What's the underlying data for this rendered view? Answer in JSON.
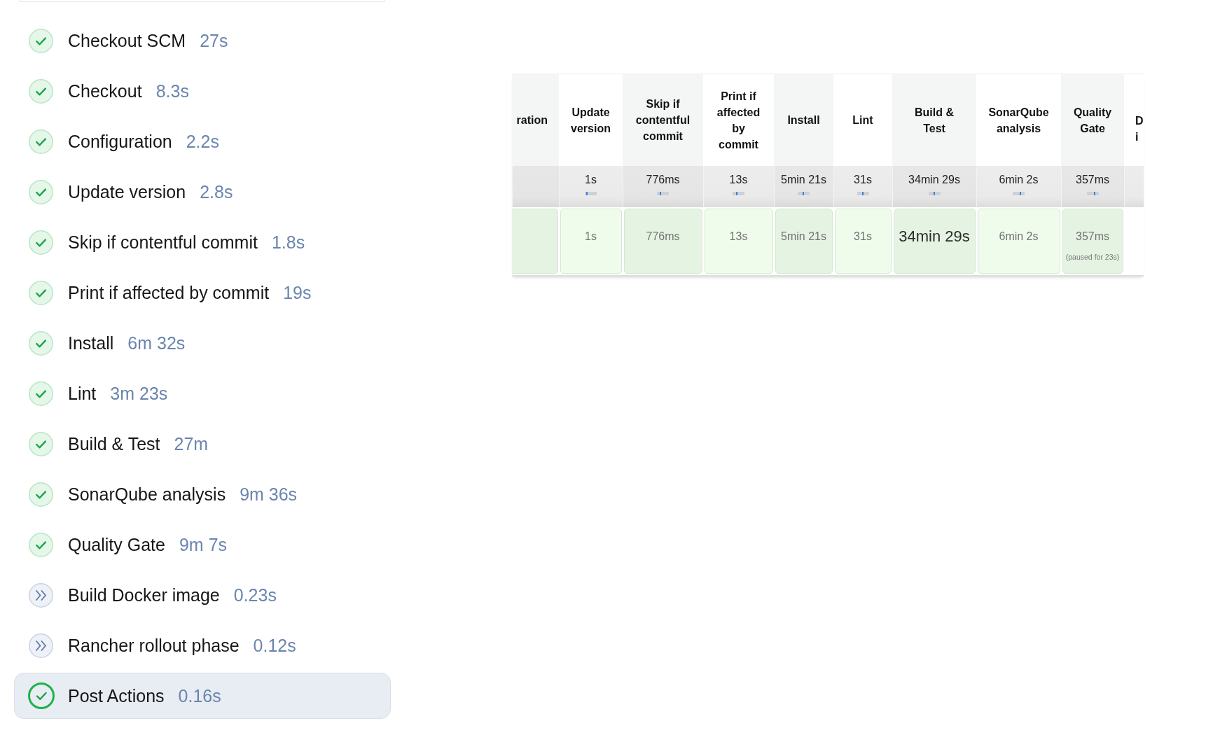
{
  "stage_list": [
    {
      "name": "Checkout SCM",
      "duration": "27s",
      "kind": "success",
      "selected": false
    },
    {
      "name": "Checkout",
      "duration": "8.3s",
      "kind": "success",
      "selected": false
    },
    {
      "name": "Configuration",
      "duration": "2.2s",
      "kind": "success",
      "selected": false
    },
    {
      "name": "Update version",
      "duration": "2.8s",
      "kind": "success",
      "selected": false
    },
    {
      "name": "Skip if contentful commit",
      "duration": "1.8s",
      "kind": "success",
      "selected": false
    },
    {
      "name": "Print if affected by commit",
      "duration": "19s",
      "kind": "success",
      "selected": false
    },
    {
      "name": "Install",
      "duration": "6m 32s",
      "kind": "success",
      "selected": false
    },
    {
      "name": "Lint",
      "duration": "3m 23s",
      "kind": "success",
      "selected": false
    },
    {
      "name": "Build & Test",
      "duration": "27m",
      "kind": "success",
      "selected": false
    },
    {
      "name": "SonarQube analysis",
      "duration": "9m 36s",
      "kind": "success",
      "selected": false
    },
    {
      "name": "Quality Gate",
      "duration": "9m 7s",
      "kind": "success",
      "selected": false
    },
    {
      "name": "Build Docker image",
      "duration": "0.23s",
      "kind": "skipped",
      "selected": false
    },
    {
      "name": "Rancher rollout phase",
      "duration": "0.12s",
      "kind": "skipped",
      "selected": false
    },
    {
      "name": "Post Actions",
      "duration": "0.16s",
      "kind": "success",
      "selected": true
    }
  ],
  "stage_table": {
    "columns": [
      {
        "header": "ration",
        "run": {
          "kind": "success"
        }
      },
      {
        "header": "Update version",
        "average": "1s",
        "level": 0.13,
        "run": {
          "kind": "success",
          "time": "1s",
          "highlighted": false
        }
      },
      {
        "header": "Skip if contentful commit",
        "average": "776ms",
        "level": 0.27,
        "run": {
          "kind": "success",
          "time": "776ms",
          "highlighted": false
        }
      },
      {
        "header": "Print if affected by commit",
        "average": "13s",
        "level": 0.35,
        "run": {
          "kind": "success",
          "time": "13s",
          "highlighted": false
        }
      },
      {
        "header": "Install",
        "average": "5min 21s",
        "level": 0.44,
        "run": {
          "kind": "success",
          "time": "5min 21s",
          "highlighted": false
        }
      },
      {
        "header": "Lint",
        "average": "31s",
        "level": 0.52,
        "run": {
          "kind": "success",
          "time": "31s",
          "highlighted": false
        }
      },
      {
        "header": "Build & Test",
        "average": "34min 29s",
        "level": 0.53,
        "run": {
          "kind": "success",
          "time": "34min 29s",
          "highlighted": true
        }
      },
      {
        "header": "SonarQube analysis",
        "average": "6min 2s",
        "level": 0.67,
        "run": {
          "kind": "success",
          "time": "6min 2s",
          "highlighted": false
        }
      },
      {
        "header": "Quality Gate",
        "average": "357ms",
        "level": 0.69,
        "run": {
          "kind": "success",
          "time": "357ms",
          "highlighted": false,
          "note": "(paused for 23s)"
        }
      },
      {
        "header": "D i"
      }
    ]
  }
}
